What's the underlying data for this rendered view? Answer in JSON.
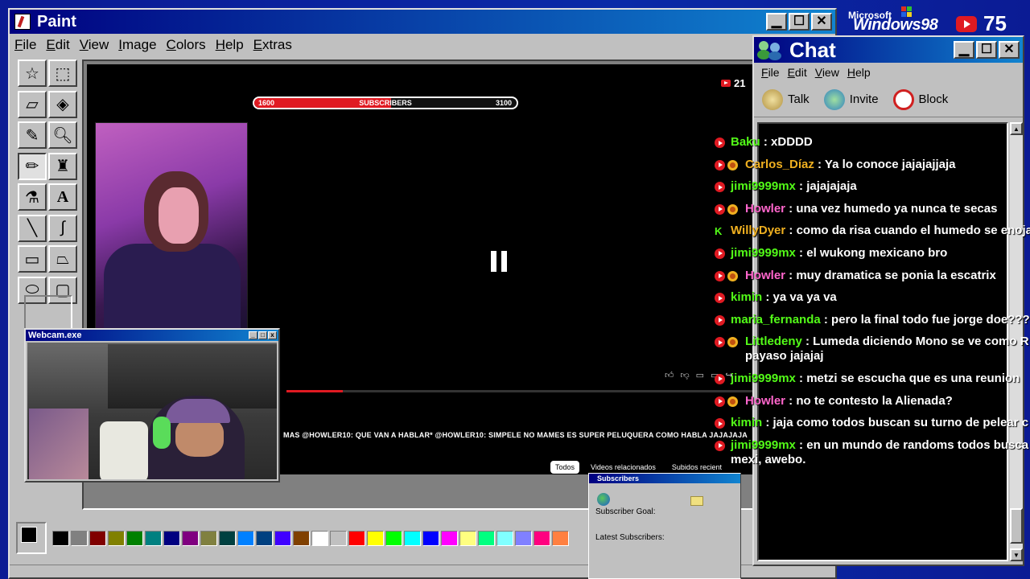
{
  "paint": {
    "title": "Paint",
    "menu": [
      "File",
      "Edit",
      "View",
      "Image",
      "Colors",
      "Help",
      "Extras"
    ],
    "tools": [
      "free-select",
      "rect-select",
      "eraser",
      "fill",
      "picker",
      "magnifier",
      "pencil",
      "brush",
      "airbrush",
      "text",
      "line",
      "curve",
      "rectangle",
      "polygon",
      "ellipse",
      "rounded-rect"
    ],
    "palette": [
      "#000000",
      "#808080",
      "#800000",
      "#808000",
      "#008000",
      "#008080",
      "#000080",
      "#800080",
      "#808040",
      "#004040",
      "#0080ff",
      "#004080",
      "#4000ff",
      "#804000",
      "#ffffff",
      "#c0c0c0",
      "#ff0000",
      "#ffff00",
      "#00ff00",
      "#00ffff",
      "#0000ff",
      "#ff00ff",
      "#ffff80",
      "#00ff80",
      "#80ffff",
      "#8080ff",
      "#ff0080",
      "#ff8040"
    ]
  },
  "stream": {
    "live_count": "21",
    "sub_goal": {
      "start": "1600",
      "label": "SUBSCRIBERS",
      "end": "3100",
      "progress": 0.52
    },
    "ticker": "MAS @HOWLER10: QUE VAN A HABLAR* @HOWLER10: SIMPELE NO MAMES ES SUPER PELUQUERA COMO HABLA JAJAJAJA",
    "tabs": [
      "Todos",
      "Videos relacionados",
      "Subidos recient"
    ],
    "video_progress": 0.12
  },
  "webcam": {
    "title": "Webcam.exe"
  },
  "subscribers_widget": {
    "title": "Subscribers",
    "goal_label": "Subscriber Goal:",
    "latest_label": "Latest Subscribers:"
  },
  "brand": {
    "microsoft": "Microsoft",
    "windows": "Windows98",
    "yt_count": "75"
  },
  "chat": {
    "title": "Chat",
    "menu": [
      "File",
      "Edit",
      "View",
      "Help"
    ],
    "toolbar": {
      "talk": "Talk",
      "invite": "Invite",
      "block": "Block"
    },
    "messages": [
      {
        "user": "Baku",
        "color": "#53fc18",
        "text": ": xDDDD",
        "badges": [
          "yt"
        ]
      },
      {
        "user": "Carlos_Díaz",
        "color": "#f0b020",
        "text": ": Ya lo conoce jajajajjaja",
        "badges": [
          "yt",
          "mod"
        ]
      },
      {
        "user": "jimi9999mx",
        "color": "#53fc18",
        "text": ": jajajajaja",
        "badges": [
          "yt"
        ]
      },
      {
        "user": "Howler",
        "color": "#ff66cc",
        "text": ": una vez humedo ya nunca te secas",
        "badges": [
          "yt",
          "mod"
        ]
      },
      {
        "user": "WillyDyer",
        "color": "#f0b020",
        "text": ": como da risa cuando el humedo se enoja",
        "badges": [
          "k"
        ]
      },
      {
        "user": "jimi9999mx",
        "color": "#53fc18",
        "text": ": el wukong mexicano bro",
        "badges": [
          "yt"
        ]
      },
      {
        "user": "Howler",
        "color": "#ff66cc",
        "text": ": muy dramatica se ponia la escatrix",
        "badges": [
          "yt",
          "mod"
        ]
      },
      {
        "user": "kimin",
        "color": "#53fc18",
        "text": ": ya va ya va",
        "badges": [
          "yt"
        ]
      },
      {
        "user": "maria_fernanda",
        "color": "#53fc18",
        "text": ": pero la final todo fue jorge doe???",
        "badges": [
          "yt"
        ]
      },
      {
        "user": "Littledeny",
        "color": "#53fc18",
        "text": ": Lumeda diciendo Mono se ve como R payaso jajajaj",
        "badges": [
          "yt",
          "mod"
        ],
        "wrap": true
      },
      {
        "user": "jimi9999mx",
        "color": "#53fc18",
        "text": ": metzi se escucha que es una reunion",
        "badges": [
          "yt"
        ]
      },
      {
        "user": "Howler",
        "color": "#ff66cc",
        "text": ": no te contesto la Alienada?",
        "badges": [
          "yt",
          "mod"
        ]
      },
      {
        "user": "kimin",
        "color": "#53fc18",
        "text": ": jaja como todos buscan su turno de pelear c",
        "badges": [
          "yt"
        ]
      },
      {
        "user": "jimi9999mx",
        "color": "#53fc18",
        "text": ": en un mundo de randoms todos busca mexi, awebo.",
        "badges": [
          "yt"
        ],
        "wrap": true
      }
    ]
  }
}
